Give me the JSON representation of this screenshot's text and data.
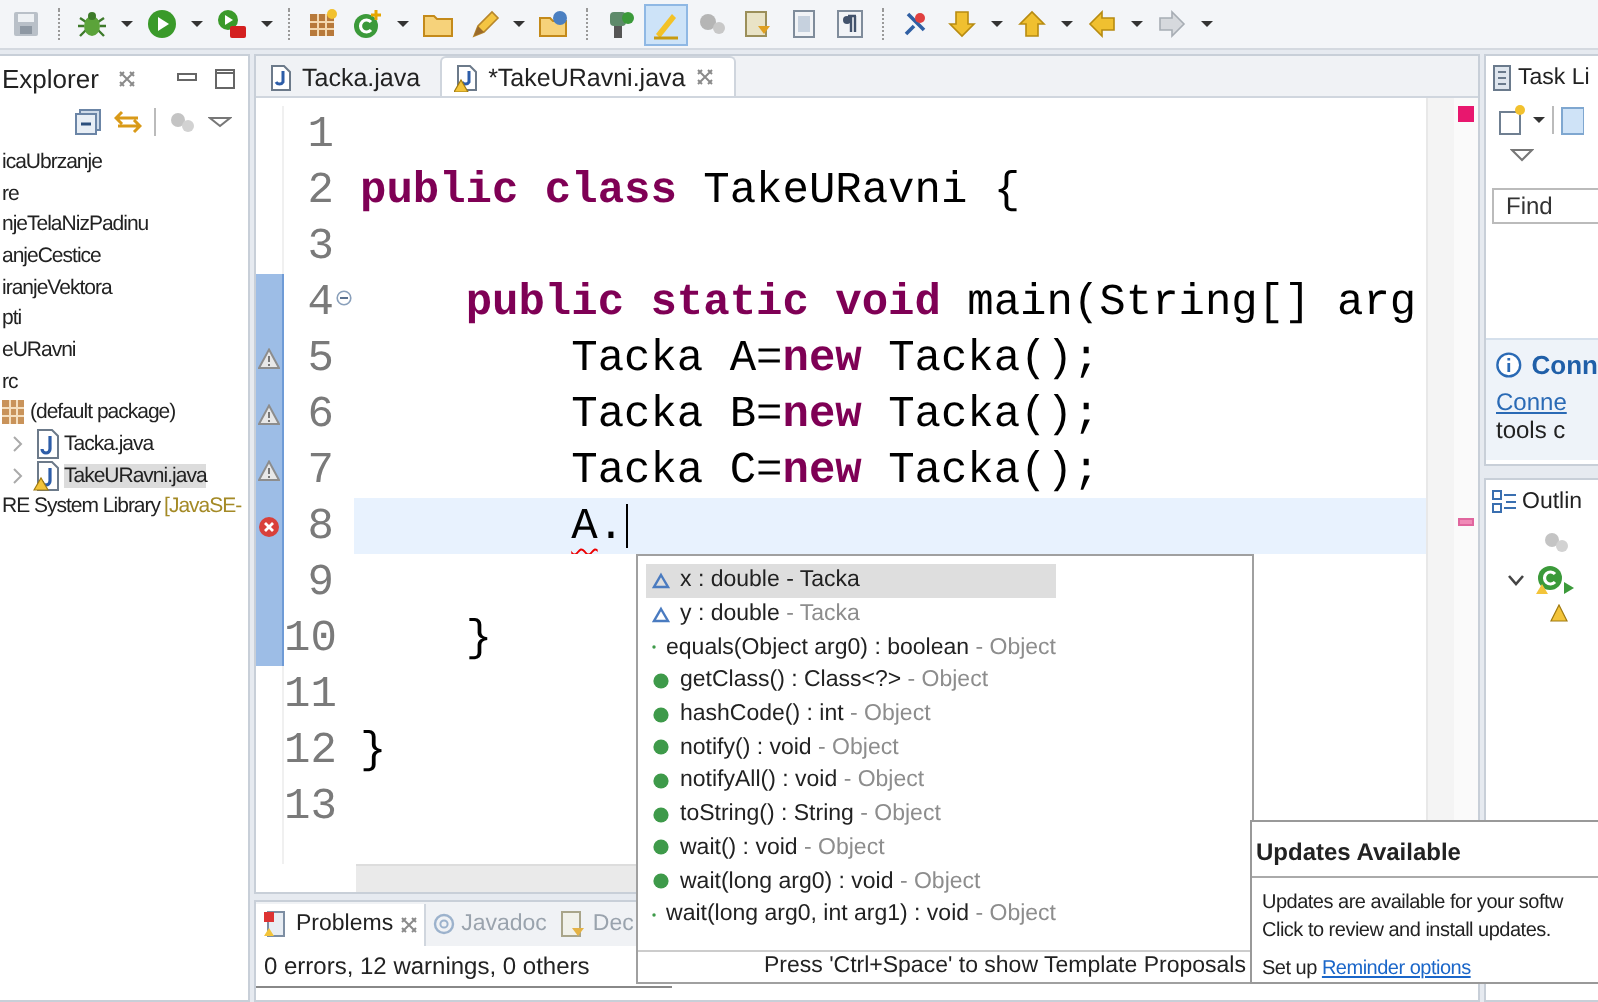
{
  "toolbar": {
    "groups": [
      [
        {
          "kind": "save",
          "on": false
        }
      ],
      [
        {
          "kind": "bug",
          "on": false
        },
        {
          "kind": "caret",
          "on": false
        },
        {
          "kind": "run",
          "on": false
        },
        {
          "kind": "caret",
          "on": false
        },
        {
          "kind": "tool",
          "on": false
        },
        {
          "kind": "caret",
          "on": false
        }
      ],
      [
        {
          "kind": "grid",
          "on": false
        },
        {
          "kind": "newclass",
          "on": false
        },
        {
          "kind": "caret",
          "on": false
        },
        {
          "kind": "folder",
          "on": false
        },
        {
          "kind": "pen",
          "on": false
        },
        {
          "kind": "caret",
          "on": false
        },
        {
          "kind": "openfolder",
          "on": false
        }
      ],
      [
        {
          "kind": "torch",
          "on": false
        },
        {
          "kind": "marker",
          "on": true
        },
        {
          "kind": "gears",
          "on": false
        },
        {
          "kind": "doc",
          "on": false
        },
        {
          "kind": "page",
          "on": false
        },
        {
          "kind": "pilcrow",
          "on": false
        }
      ],
      [
        {
          "kind": "pin",
          "on": false
        },
        {
          "kind": "down",
          "on": false
        },
        {
          "kind": "caret",
          "on": false
        },
        {
          "kind": "up",
          "on": false
        },
        {
          "kind": "caret",
          "on": false
        },
        {
          "kind": "back",
          "on": false
        },
        {
          "kind": "caret",
          "on": false
        },
        {
          "kind": "forward",
          "on": false
        },
        {
          "kind": "caret",
          "on": false
        }
      ]
    ]
  },
  "explorer": {
    "title": "Explorer",
    "items": [
      {
        "label": "icaUbrzanje",
        "selected": false
      },
      {
        "label": "re",
        "selected": false
      },
      {
        "label": "njeTelaNizPadinu",
        "selected": false
      },
      {
        "label": "anjeCestice",
        "selected": false
      },
      {
        "label": "iranjeVektora",
        "selected": false
      },
      {
        "label": "pti",
        "selected": false
      },
      {
        "label": "eURavni",
        "selected": false,
        "children": [
          {
            "label": "rc",
            "selected": false,
            "children": [
              {
                "label": "(default package)",
                "kind": "package",
                "selected": false,
                "children": [
                  {
                    "label": "Tacka.java",
                    "kind": "java",
                    "selected": false,
                    "expanded": false,
                    "warning": false
                  },
                  {
                    "label": "TakeURavni.java",
                    "kind": "java",
                    "selected": true,
                    "expanded": false,
                    "warning": true
                  }
                ]
              }
            ]
          },
          {
            "label": "RE System Library",
            "suffix": "[JavaSE-",
            "selected": false
          }
        ]
      }
    ]
  },
  "editor": {
    "tabs": [
      {
        "label": "Tacka.java",
        "selected": false,
        "warning": false
      },
      {
        "label": "*TakeURavni.java",
        "selected": true,
        "warning": true
      }
    ],
    "lines": [
      {
        "number": "1",
        "range": false,
        "current": false,
        "warning": false,
        "error": false
      },
      {
        "number": "2",
        "range": false,
        "current": false,
        "warning": false,
        "error": false,
        "tokens": [
          {
            "text": "public class",
            "kind": "keyword"
          },
          {
            "text": " TakeURavni {",
            "kind": "plain"
          }
        ]
      },
      {
        "number": "3",
        "range": false,
        "current": false,
        "warning": false,
        "error": false
      },
      {
        "number": "4",
        "range": true,
        "current": false,
        "warning": false,
        "error": false,
        "fold": true,
        "tokens": [
          {
            "text": "    public static void",
            "kind": "keyword"
          },
          {
            "text": " main(String[] arg",
            "kind": "plain"
          }
        ]
      },
      {
        "number": "5",
        "range": true,
        "current": false,
        "warning": true,
        "error": false,
        "tokens": [
          {
            "text": "        Tacka A=",
            "kind": "plain"
          },
          {
            "text": "new",
            "kind": "keyword"
          },
          {
            "text": " Tacka();",
            "kind": "plain"
          }
        ]
      },
      {
        "number": "6",
        "range": true,
        "current": false,
        "warning": true,
        "error": false,
        "tokens": [
          {
            "text": "        Tacka B=",
            "kind": "plain"
          },
          {
            "text": "new",
            "kind": "keyword"
          },
          {
            "text": " Tacka();",
            "kind": "plain"
          }
        ]
      },
      {
        "number": "7",
        "range": true,
        "current": false,
        "warning": true,
        "error": false,
        "tokens": [
          {
            "text": "        Tacka C=",
            "kind": "plain"
          },
          {
            "text": "new",
            "kind": "keyword"
          },
          {
            "text": " Tacka();",
            "kind": "plain"
          }
        ]
      },
      {
        "number": "8",
        "range": true,
        "current": true,
        "warning": false,
        "error": true,
        "tokens": [
          {
            "text": "        A",
            "kind": "plain",
            "squiggle": true
          },
          {
            "text": ".",
            "kind": "plain"
          }
        ]
      },
      {
        "number": "9",
        "range": true,
        "current": false,
        "warning": false,
        "error": false
      },
      {
        "number": "10",
        "range": true,
        "current": false,
        "warning": false,
        "error": false,
        "tokens": [
          {
            "text": "    }",
            "kind": "plain"
          }
        ]
      },
      {
        "number": "11",
        "range": false,
        "current": false,
        "warning": false,
        "error": false
      },
      {
        "number": "12",
        "range": false,
        "current": false,
        "warning": false,
        "error": false,
        "tokens": [
          {
            "text": "}",
            "kind": "plain"
          }
        ]
      },
      {
        "number": "13",
        "range": false,
        "current": false,
        "warning": false,
        "error": false
      }
    ]
  },
  "completion": {
    "items": [
      {
        "kind": "field",
        "text": "x : double",
        "owner": "- Tacka",
        "selected": true
      },
      {
        "kind": "field",
        "text": "y : double",
        "owner": "- Tacka",
        "selected": false
      },
      {
        "kind": "method",
        "text": "equals(Object arg0) : boolean",
        "owner": "- Object",
        "selected": false
      },
      {
        "kind": "method",
        "text": "getClass() : Class<?>",
        "owner": "- Object",
        "selected": false
      },
      {
        "kind": "method",
        "text": "hashCode() : int",
        "owner": "- Object",
        "selected": false
      },
      {
        "kind": "method",
        "text": "notify() : void",
        "owner": "- Object",
        "selected": false
      },
      {
        "kind": "method",
        "text": "notifyAll() : void",
        "owner": "- Object",
        "selected": false
      },
      {
        "kind": "method",
        "text": "toString() : String",
        "owner": "- Object",
        "selected": false
      },
      {
        "kind": "method",
        "text": "wait() : void",
        "owner": "- Object",
        "selected": false
      },
      {
        "kind": "method",
        "text": "wait(long arg0) : void",
        "owner": "- Object",
        "selected": false
      },
      {
        "kind": "method",
        "text": "wait(long arg0, int arg1) : void",
        "owner": "- Object",
        "selected": false
      }
    ],
    "footer": "Press 'Ctrl+Space' to show Template Proposals"
  },
  "bottom_panel": {
    "tabs": [
      {
        "label": "Problems",
        "kind": "problems",
        "selected": true
      },
      {
        "label": "Javadoc",
        "kind": "javadoc",
        "selected": false
      },
      {
        "label": "Dec",
        "kind": "declaration",
        "selected": false
      }
    ],
    "summary": "0 errors, 12 warnings, 0 others"
  },
  "notification": {
    "title": "Updates Available",
    "lines": [
      "Updates are available for your softw",
      "Click to review and install updates."
    ],
    "setup": "Set up",
    "link": "Reminder options"
  },
  "task_list": {
    "title": "Task Li",
    "find_placeholder": "Find"
  },
  "connect": {
    "title": "Conn",
    "link": "Conne",
    "text": "tools c"
  },
  "outline": {
    "title": "Outlin"
  }
}
